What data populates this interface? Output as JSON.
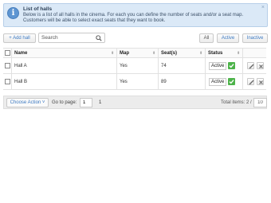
{
  "info": {
    "title": "List of halls",
    "text": "Below is a list of all halls in the cinema. For each you can define the number of seats and/or a seat map. Customers will be able to select exact seats that they want to book.",
    "close": "×"
  },
  "toolbar": {
    "add_label": "+ Add hall",
    "search_placeholder": "Search",
    "filters": [
      "All",
      "Active",
      "Inactive"
    ]
  },
  "table": {
    "columns": [
      "Name",
      "Map",
      "Seat(s)",
      "Status"
    ],
    "rows": [
      {
        "name": "Hall A",
        "map": "Yes",
        "seats": "74",
        "status": "Active"
      },
      {
        "name": "Hall B",
        "map": "Yes",
        "seats": "89",
        "status": "Active"
      }
    ]
  },
  "footer": {
    "choose_action": "Choose Action ˅",
    "goto_label": "Go to page:",
    "page_value": "1",
    "page_link": "1",
    "total_label": "Total items: 2 /",
    "per_page": "10"
  },
  "colors": {
    "info_bg": "#dbe9f7",
    "accent": "#3d7ac2",
    "status_ok": "#4db34a"
  }
}
